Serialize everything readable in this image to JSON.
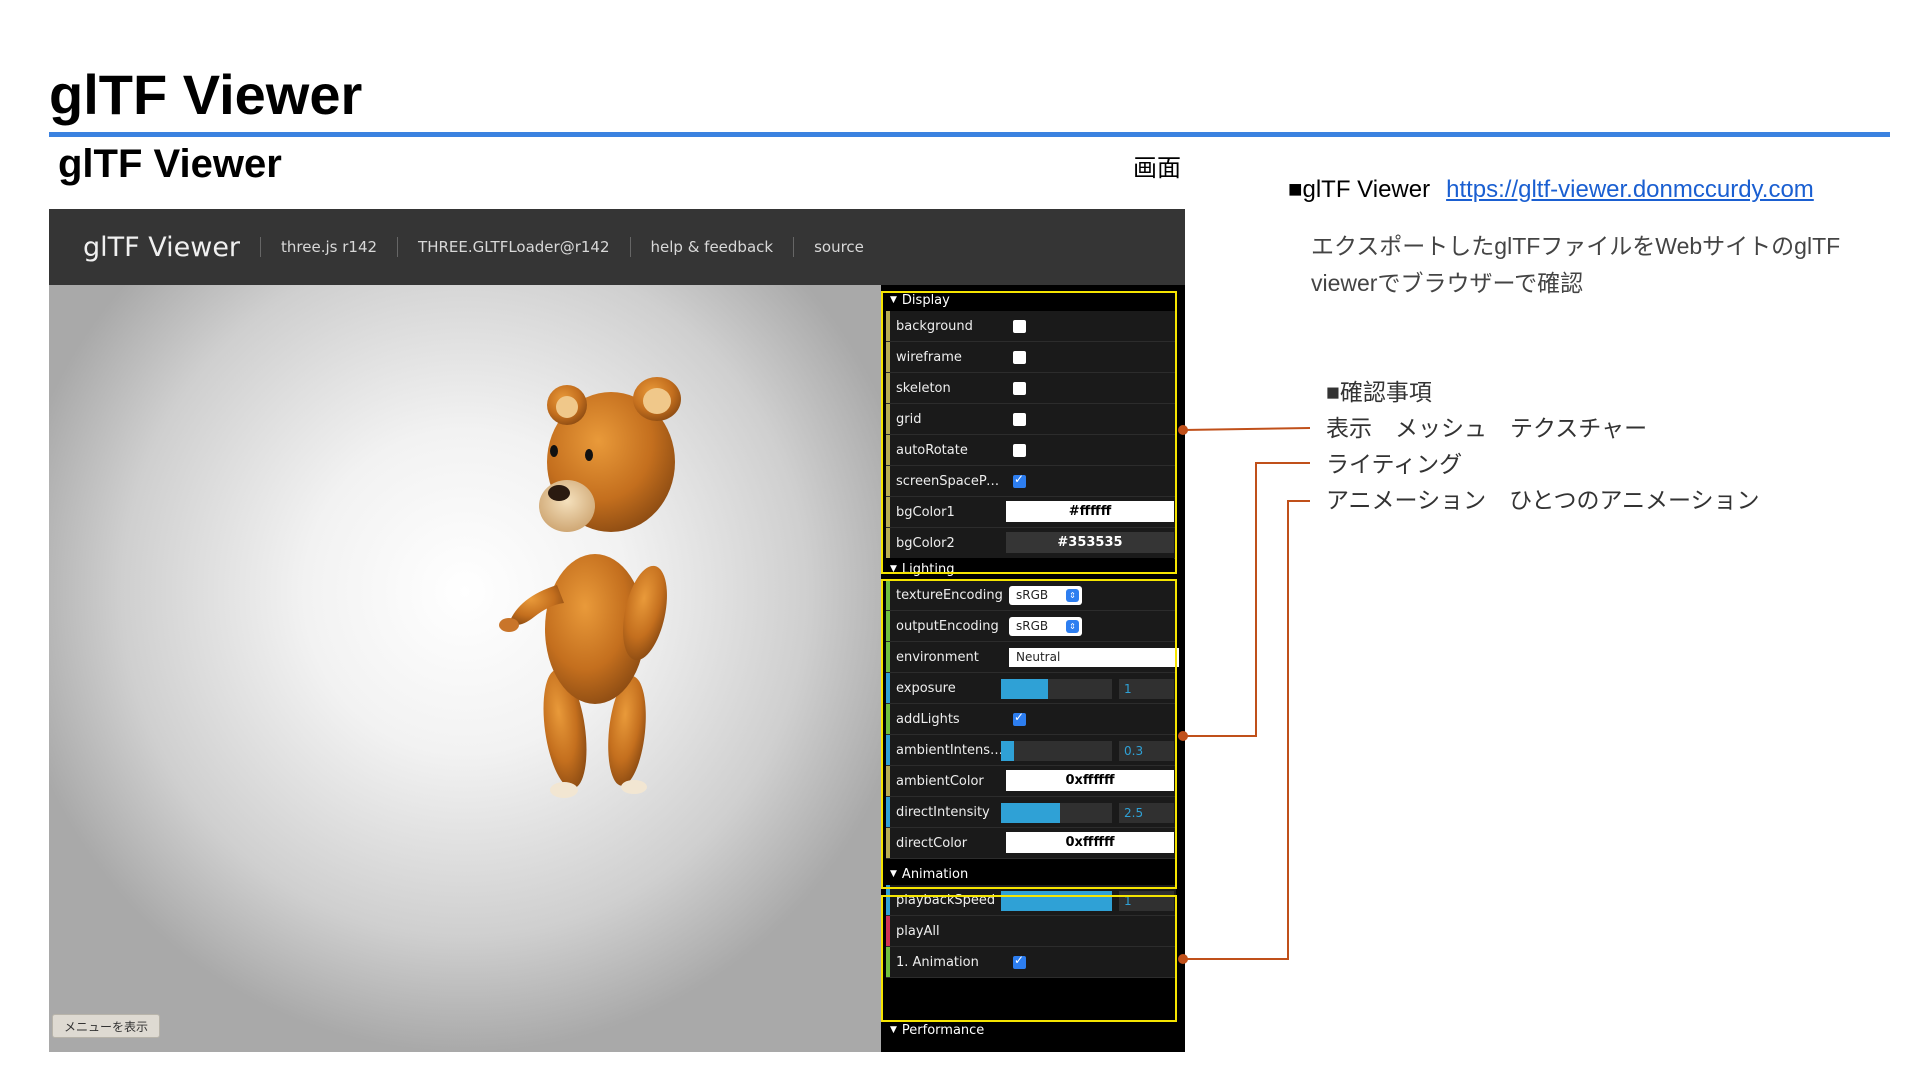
{
  "slide": {
    "title": "glTF Viewer",
    "subtitle": "glTF Viewer",
    "screen_label": "画面"
  },
  "app": {
    "brand": "glTF Viewer",
    "nav": [
      "three.js r142",
      "THREE.GLTFLoader@r142",
      "help & feedback",
      "source"
    ],
    "menu_button": "メニューを表示"
  },
  "gui": {
    "display": {
      "title": "Display",
      "background_label": "background",
      "wireframe_label": "wireframe",
      "skeleton_label": "skeleton",
      "grid_label": "grid",
      "autorotate_label": "autoRotate",
      "screenspace_label": "screenSpacePa...",
      "bgcolor1_label": "bgColor1",
      "bgcolor1_value": "#ffffff",
      "bgcolor2_label": "bgColor2",
      "bgcolor2_value": "#353535",
      "checked": {
        "background": false,
        "wireframe": false,
        "skeleton": false,
        "grid": false,
        "autoRotate": false,
        "screenSpacePanning": true
      }
    },
    "lighting": {
      "title": "Lighting",
      "texture_label": "textureEncoding",
      "texture_value": "sRGB",
      "output_label": "outputEncoding",
      "output_value": "sRGB",
      "env_label": "environment",
      "env_value": "Neutral",
      "exposure_label": "exposure",
      "exposure_value": "1",
      "exposure_fill": 0.42,
      "addlights_label": "addLights",
      "ambient_int_label": "ambientIntensity",
      "ambient_int_value": "0.3",
      "ambient_int_fill": 0.12,
      "ambient_color_label": "ambientColor",
      "ambient_color_value": "0xffffff",
      "direct_int_label": "directIntensity",
      "direct_int_value": "2.5",
      "direct_int_fill": 0.53,
      "direct_color_label": "directColor",
      "direct_color_value": "0xffffff"
    },
    "animation": {
      "title": "Animation",
      "speed_label": "playbackSpeed",
      "speed_value": "1",
      "speed_fill": 1.0,
      "playall_label": "playAll",
      "anim1_label": "1. Animation"
    },
    "performance": {
      "title": "Performance"
    }
  },
  "notes": {
    "ref_prefix": "■glTF Viewer",
    "ref_url": "https://gltf-viewer.donmccurdy.com",
    "description": "エクスポートしたglTFファイルをWebサイトのglTF viewerでブラウザーで確認",
    "check_header": "■確認事項",
    "check_items": [
      "表示　メッシュ　テクスチャー",
      "ライティング",
      "アニメーション　ひとつのアニメーション"
    ]
  },
  "colors": {
    "accent_rule": "#3b82e0",
    "highlight_box": "#f5e400",
    "connector": "#c0501a",
    "slider_fill": "#2fa1d6",
    "folder_display": "#b6ab55",
    "folder_green": "#6fbf3f",
    "folder_blue": "#2fa1d6",
    "folder_red": "#d13355"
  }
}
